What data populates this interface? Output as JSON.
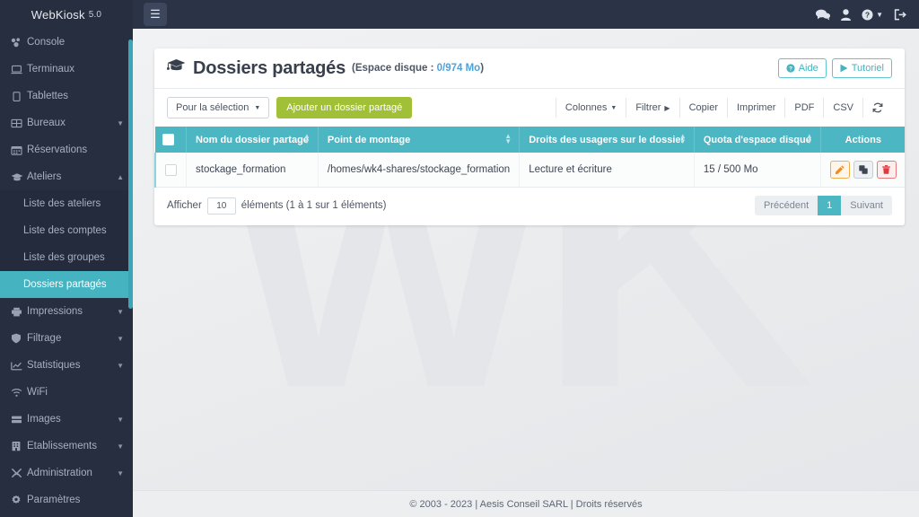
{
  "brand": {
    "name": "WebKiosk",
    "version": "5.0"
  },
  "topbar": {
    "menu_toggle_icon": "hamburger-icon",
    "icons": [
      {
        "name": "chat-icon",
        "glyph": "💬"
      },
      {
        "name": "user-icon",
        "glyph": "👤"
      },
      {
        "name": "help-icon",
        "glyph": "?"
      },
      {
        "name": "logout-icon",
        "glyph": "→]"
      }
    ]
  },
  "sidebar": {
    "items": [
      {
        "label": "Console",
        "icon": "console-icon",
        "expandable": false
      },
      {
        "label": "Terminaux",
        "icon": "laptop-icon",
        "expandable": false
      },
      {
        "label": "Tablettes",
        "icon": "tablet-icon",
        "expandable": false
      },
      {
        "label": "Bureaux",
        "icon": "grid-icon",
        "expandable": true
      },
      {
        "label": "Réservations",
        "icon": "calendar-icon",
        "expandable": false
      },
      {
        "label": "Ateliers",
        "icon": "graduation-cap-icon",
        "expandable": true,
        "expanded": true
      },
      {
        "label": "Impressions",
        "icon": "printer-icon",
        "expandable": true
      },
      {
        "label": "Filtrage",
        "icon": "shield-icon",
        "expandable": true
      },
      {
        "label": "Statistiques",
        "icon": "chart-icon",
        "expandable": true
      },
      {
        "label": "WiFi",
        "icon": "wifi-icon",
        "expandable": false
      },
      {
        "label": "Images",
        "icon": "server-icon",
        "expandable": true
      },
      {
        "label": "Établissements",
        "icon": "building-icon",
        "expandable": true
      },
      {
        "label": "Administration",
        "icon": "tools-icon",
        "expandable": true
      },
      {
        "label": "Paramètres",
        "icon": "gear-icon",
        "expandable": false
      }
    ],
    "ateliers_submenu": [
      {
        "label": "Liste des ateliers",
        "active": false
      },
      {
        "label": "Liste des comptes",
        "active": false
      },
      {
        "label": "Liste des groupes",
        "active": false
      },
      {
        "label": "Dossiers partagés",
        "active": true
      }
    ]
  },
  "page": {
    "title": "Dossiers partagés",
    "subtitle_prefix": "(Espace disque : ",
    "subtitle_value": "0/974 Mo",
    "subtitle_suffix": ")",
    "title_icon": "graduation-cap-icon",
    "help_button": "Aide",
    "tutorial_button": "Tutoriel"
  },
  "toolbar": {
    "selection_label": "Pour la sélection",
    "add_label": "Ajouter un dossier partagé",
    "right_buttons": [
      {
        "label": "Colonnes",
        "caret": "down"
      },
      {
        "label": "Filtrer",
        "caret": "right"
      },
      {
        "label": "Copier",
        "caret": ""
      },
      {
        "label": "Imprimer",
        "caret": ""
      },
      {
        "label": "PDF",
        "caret": ""
      },
      {
        "label": "CSV",
        "caret": ""
      }
    ],
    "refresh_icon": "refresh-icon"
  },
  "table": {
    "columns": [
      {
        "label": "Nom du dossier partagé",
        "sortable": true
      },
      {
        "label": "Point de montage",
        "sortable": true
      },
      {
        "label": "Droits des usagers sur le dossier",
        "sortable": true
      },
      {
        "label": "Quota d'espace disque",
        "sortable": true
      },
      {
        "label": "Actions",
        "sortable": false
      }
    ],
    "rows": [
      {
        "nom": "stockage_formation",
        "point_de_montage": "/homes/wk4-shares/stockage_formation",
        "droits": "Lecture et écriture",
        "quota": "15 / 500 Mo",
        "actions": [
          {
            "name": "edit-button",
            "icon": "pencil-icon"
          },
          {
            "name": "duplicate-button",
            "icon": "copy-icon"
          },
          {
            "name": "delete-button",
            "icon": "trash-icon"
          }
        ]
      }
    ]
  },
  "footer_bar": {
    "show_label": "Afficher",
    "page_length": "10",
    "entries_info": "éléments (1 à 1 sur 1 éléments)",
    "prev_label": "Précédent",
    "current_page": "1",
    "next_label": "Suivant"
  },
  "footer": {
    "copyright": "© 2003 - 2023 | Aesis Conseil SARL | Droits réservés"
  },
  "colors": {
    "sidebar_bg": "#262e40",
    "topbar_bg": "#2b3447",
    "accent_teal": "#4cb6c3",
    "accent_green": "#a2c037",
    "link_blue": "#4aa3df",
    "edit_orange": "#ef8b1e",
    "delete_red": "#e03a3f"
  },
  "watermark": {
    "text": "wK"
  }
}
